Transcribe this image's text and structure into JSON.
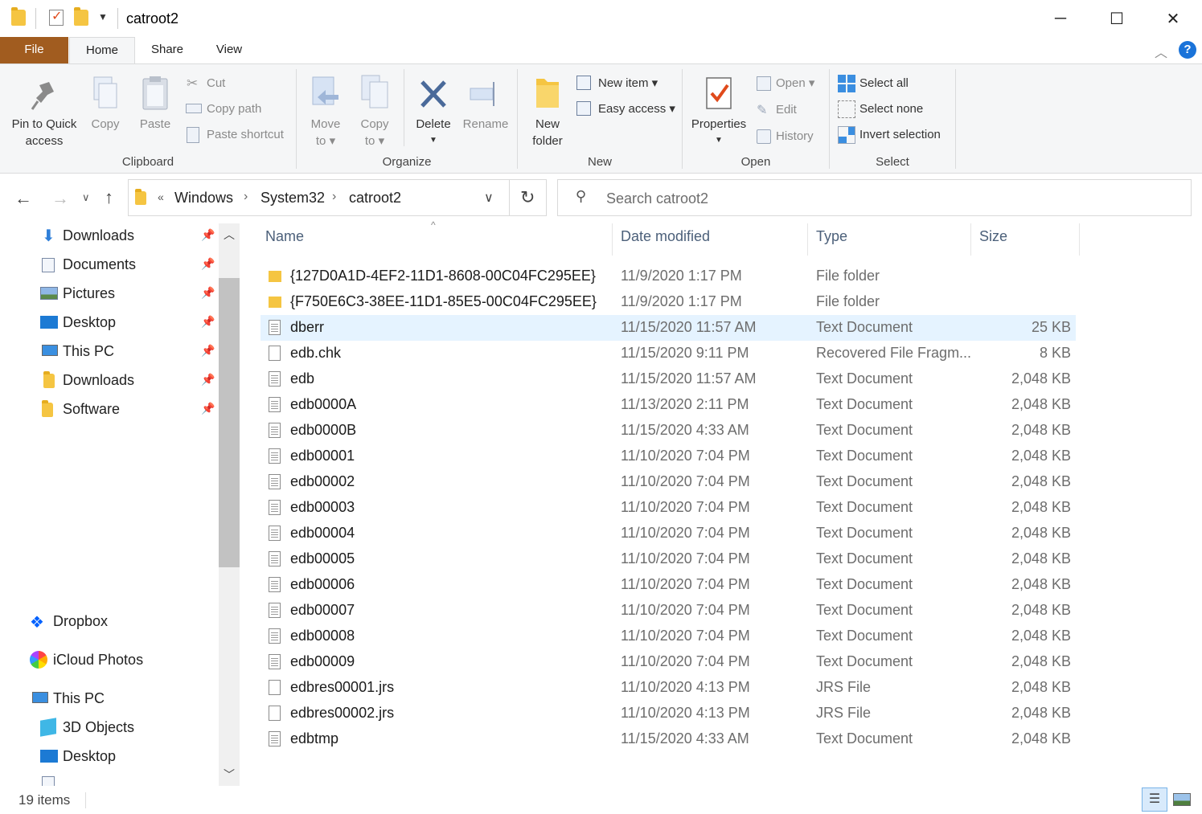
{
  "window": {
    "title": "catroot2",
    "minimize": "─",
    "maximize": "☐",
    "close": "✕"
  },
  "tabs": {
    "file": "File",
    "home": "Home",
    "share": "Share",
    "view": "View"
  },
  "ribbon": {
    "clipboard": {
      "label": "Clipboard",
      "pin": "Pin to Quick access",
      "pin_line1": "Pin to Quick",
      "pin_line2": "access",
      "copy": "Copy",
      "paste": "Paste",
      "cut": "Cut",
      "copy_path": "Copy path",
      "paste_shortcut": "Paste shortcut"
    },
    "organize": {
      "label": "Organize",
      "move_line1": "Move",
      "move_line2": "to ▾",
      "copy_line1": "Copy",
      "copy_line2": "to ▾",
      "delete": "Delete",
      "rename": "Rename"
    },
    "new": {
      "label": "New",
      "new_folder_line1": "New",
      "new_folder_line2": "folder",
      "new_item": "New item ▾",
      "easy_access": "Easy access ▾"
    },
    "open": {
      "label": "Open",
      "properties": "Properties",
      "open": "Open ▾",
      "edit": "Edit",
      "history": "History"
    },
    "select": {
      "label": "Select",
      "select_all": "Select all",
      "select_none": "Select none",
      "invert": "Invert selection"
    }
  },
  "address": {
    "overflow": "«",
    "crumbs": [
      "Windows",
      "System32",
      "catroot2"
    ],
    "search_placeholder": "Search catroot2"
  },
  "nav_pane": {
    "quick_access": [
      {
        "label": "Downloads"
      },
      {
        "label": "Documents"
      },
      {
        "label": "Pictures"
      },
      {
        "label": "Desktop"
      },
      {
        "label": "This PC"
      },
      {
        "label": "Downloads"
      },
      {
        "label": "Software"
      }
    ],
    "dropbox": "Dropbox",
    "icloud": "iCloud Photos",
    "this_pc": "This PC",
    "this_pc_items": [
      "3D Objects",
      "Desktop"
    ]
  },
  "columns": {
    "name": "Name",
    "date": "Date modified",
    "type": "Type",
    "size": "Size"
  },
  "files": [
    {
      "name": "{127D0A1D-4EF2-11D1-8608-00C04FC295EE}",
      "date": "11/9/2020 1:17 PM",
      "type": "File folder",
      "size": "",
      "icon": "folder-icon"
    },
    {
      "name": "{F750E6C3-38EE-11D1-85E5-00C04FC295EE}",
      "date": "11/9/2020 1:17 PM",
      "type": "File folder",
      "size": "",
      "icon": "folder-icon"
    },
    {
      "name": "dberr",
      "date": "11/15/2020 11:57 AM",
      "type": "Text Document",
      "size": "25 KB",
      "icon": "text-file-icon"
    },
    {
      "name": "edb.chk",
      "date": "11/15/2020 9:11 PM",
      "type": "Recovered File Fragm...",
      "size": "8 KB",
      "icon": "chk-file-icon"
    },
    {
      "name": "edb",
      "date": "11/15/2020 11:57 AM",
      "type": "Text Document",
      "size": "2,048 KB",
      "icon": "text-file-icon"
    },
    {
      "name": "edb0000A",
      "date": "11/13/2020 2:11 PM",
      "type": "Text Document",
      "size": "2,048 KB",
      "icon": "text-file-icon"
    },
    {
      "name": "edb0000B",
      "date": "11/15/2020 4:33 AM",
      "type": "Text Document",
      "size": "2,048 KB",
      "icon": "text-file-icon"
    },
    {
      "name": "edb00001",
      "date": "11/10/2020 7:04 PM",
      "type": "Text Document",
      "size": "2,048 KB",
      "icon": "text-file-icon"
    },
    {
      "name": "edb00002",
      "date": "11/10/2020 7:04 PM",
      "type": "Text Document",
      "size": "2,048 KB",
      "icon": "text-file-icon"
    },
    {
      "name": "edb00003",
      "date": "11/10/2020 7:04 PM",
      "type": "Text Document",
      "size": "2,048 KB",
      "icon": "text-file-icon"
    },
    {
      "name": "edb00004",
      "date": "11/10/2020 7:04 PM",
      "type": "Text Document",
      "size": "2,048 KB",
      "icon": "text-file-icon"
    },
    {
      "name": "edb00005",
      "date": "11/10/2020 7:04 PM",
      "type": "Text Document",
      "size": "2,048 KB",
      "icon": "text-file-icon"
    },
    {
      "name": "edb00006",
      "date": "11/10/2020 7:04 PM",
      "type": "Text Document",
      "size": "2,048 KB",
      "icon": "text-file-icon"
    },
    {
      "name": "edb00007",
      "date": "11/10/2020 7:04 PM",
      "type": "Text Document",
      "size": "2,048 KB",
      "icon": "text-file-icon"
    },
    {
      "name": "edb00008",
      "date": "11/10/2020 7:04 PM",
      "type": "Text Document",
      "size": "2,048 KB",
      "icon": "text-file-icon"
    },
    {
      "name": "edb00009",
      "date": "11/10/2020 7:04 PM",
      "type": "Text Document",
      "size": "2,048 KB",
      "icon": "text-file-icon"
    },
    {
      "name": "edbres00001.jrs",
      "date": "11/10/2020 4:13 PM",
      "type": "JRS File",
      "size": "2,048 KB",
      "icon": "blank-file-icon"
    },
    {
      "name": "edbres00002.jrs",
      "date": "11/10/2020 4:13 PM",
      "type": "JRS File",
      "size": "2,048 KB",
      "icon": "blank-file-icon"
    },
    {
      "name": "edbtmp",
      "date": "11/15/2020 4:33 AM",
      "type": "Text Document",
      "size": "2,048 KB",
      "icon": "text-file-icon"
    }
  ],
  "selected_index": 2,
  "status": {
    "count": "19 items"
  },
  "colors": {
    "file_tab": "#a15c1f",
    "selection": "#e5f3ff",
    "header_text": "#4c607a",
    "accent": "#1a73d9"
  }
}
